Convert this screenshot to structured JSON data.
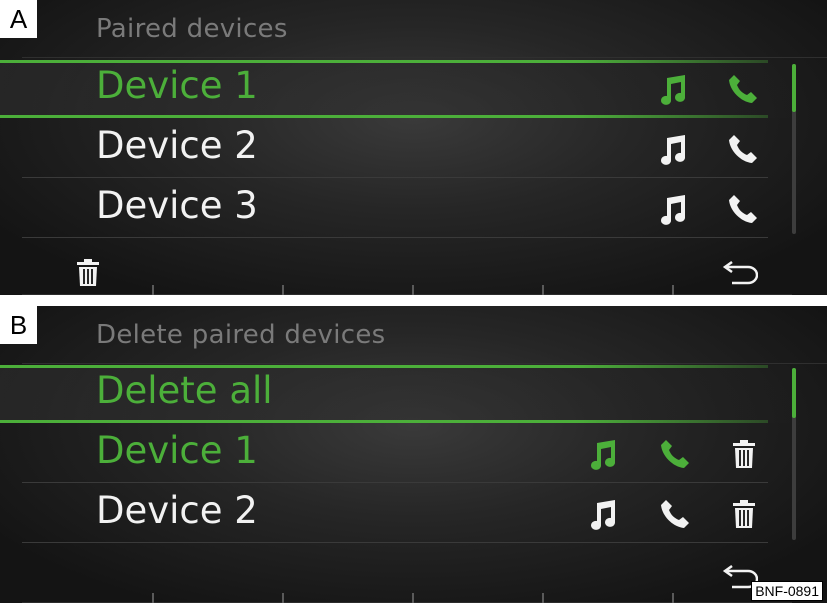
{
  "panel_a": {
    "tag": "A",
    "title": "Paired devices",
    "devices": [
      {
        "label": "Device 1",
        "state": "selected"
      },
      {
        "label": "Device 2",
        "state": "normal"
      },
      {
        "label": "Device 3",
        "state": "normal"
      }
    ],
    "toolbar": {
      "left_icon": "trash-icon",
      "right_icon": "back-arrow-icon"
    }
  },
  "panel_b": {
    "tag": "B",
    "title": "Delete paired devices",
    "rows": [
      {
        "label": "Delete all",
        "state": "selected"
      },
      {
        "label": "Device 1",
        "state": "active"
      },
      {
        "label": "Device 2",
        "state": "normal"
      }
    ],
    "toolbar": {
      "right_icon": "back-arrow-icon"
    }
  },
  "figure_code": "BNF-0891",
  "colors": {
    "accent": "#4caf3a",
    "text": "#f2f2f2",
    "muted": "#7a7a7a"
  },
  "scroll_position": 0.33
}
